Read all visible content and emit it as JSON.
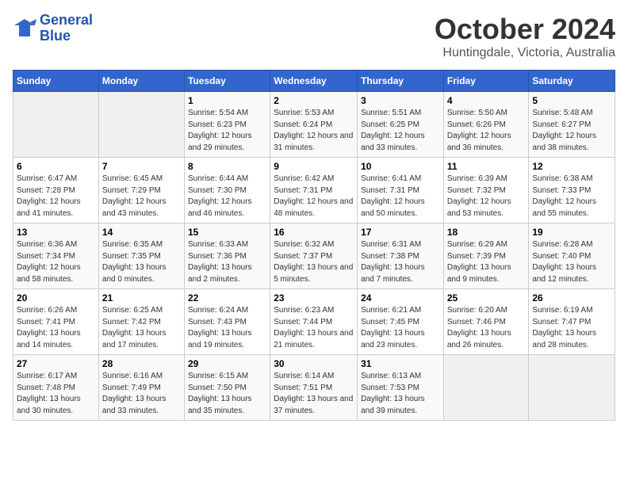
{
  "header": {
    "logo_line1": "General",
    "logo_line2": "Blue",
    "month": "October 2024",
    "location": "Huntingdale, Victoria, Australia"
  },
  "weekdays": [
    "Sunday",
    "Monday",
    "Tuesday",
    "Wednesday",
    "Thursday",
    "Friday",
    "Saturday"
  ],
  "weeks": [
    [
      {
        "day": "",
        "detail": ""
      },
      {
        "day": "",
        "detail": ""
      },
      {
        "day": "1",
        "detail": "Sunrise: 5:54 AM\nSunset: 6:23 PM\nDaylight: 12 hours and 29 minutes."
      },
      {
        "day": "2",
        "detail": "Sunrise: 5:53 AM\nSunset: 6:24 PM\nDaylight: 12 hours and 31 minutes."
      },
      {
        "day": "3",
        "detail": "Sunrise: 5:51 AM\nSunset: 6:25 PM\nDaylight: 12 hours and 33 minutes."
      },
      {
        "day": "4",
        "detail": "Sunrise: 5:50 AM\nSunset: 6:26 PM\nDaylight: 12 hours and 36 minutes."
      },
      {
        "day": "5",
        "detail": "Sunrise: 5:48 AM\nSunset: 6:27 PM\nDaylight: 12 hours and 38 minutes."
      }
    ],
    [
      {
        "day": "6",
        "detail": "Sunrise: 6:47 AM\nSunset: 7:28 PM\nDaylight: 12 hours and 41 minutes."
      },
      {
        "day": "7",
        "detail": "Sunrise: 6:45 AM\nSunset: 7:29 PM\nDaylight: 12 hours and 43 minutes."
      },
      {
        "day": "8",
        "detail": "Sunrise: 6:44 AM\nSunset: 7:30 PM\nDaylight: 12 hours and 46 minutes."
      },
      {
        "day": "9",
        "detail": "Sunrise: 6:42 AM\nSunset: 7:31 PM\nDaylight: 12 hours and 48 minutes."
      },
      {
        "day": "10",
        "detail": "Sunrise: 6:41 AM\nSunset: 7:31 PM\nDaylight: 12 hours and 50 minutes."
      },
      {
        "day": "11",
        "detail": "Sunrise: 6:39 AM\nSunset: 7:32 PM\nDaylight: 12 hours and 53 minutes."
      },
      {
        "day": "12",
        "detail": "Sunrise: 6:38 AM\nSunset: 7:33 PM\nDaylight: 12 hours and 55 minutes."
      }
    ],
    [
      {
        "day": "13",
        "detail": "Sunrise: 6:36 AM\nSunset: 7:34 PM\nDaylight: 12 hours and 58 minutes."
      },
      {
        "day": "14",
        "detail": "Sunrise: 6:35 AM\nSunset: 7:35 PM\nDaylight: 13 hours and 0 minutes."
      },
      {
        "day": "15",
        "detail": "Sunrise: 6:33 AM\nSunset: 7:36 PM\nDaylight: 13 hours and 2 minutes."
      },
      {
        "day": "16",
        "detail": "Sunrise: 6:32 AM\nSunset: 7:37 PM\nDaylight: 13 hours and 5 minutes."
      },
      {
        "day": "17",
        "detail": "Sunrise: 6:31 AM\nSunset: 7:38 PM\nDaylight: 13 hours and 7 minutes."
      },
      {
        "day": "18",
        "detail": "Sunrise: 6:29 AM\nSunset: 7:39 PM\nDaylight: 13 hours and 9 minutes."
      },
      {
        "day": "19",
        "detail": "Sunrise: 6:28 AM\nSunset: 7:40 PM\nDaylight: 13 hours and 12 minutes."
      }
    ],
    [
      {
        "day": "20",
        "detail": "Sunrise: 6:26 AM\nSunset: 7:41 PM\nDaylight: 13 hours and 14 minutes."
      },
      {
        "day": "21",
        "detail": "Sunrise: 6:25 AM\nSunset: 7:42 PM\nDaylight: 13 hours and 17 minutes."
      },
      {
        "day": "22",
        "detail": "Sunrise: 6:24 AM\nSunset: 7:43 PM\nDaylight: 13 hours and 19 minutes."
      },
      {
        "day": "23",
        "detail": "Sunrise: 6:23 AM\nSunset: 7:44 PM\nDaylight: 13 hours and 21 minutes."
      },
      {
        "day": "24",
        "detail": "Sunrise: 6:21 AM\nSunset: 7:45 PM\nDaylight: 13 hours and 23 minutes."
      },
      {
        "day": "25",
        "detail": "Sunrise: 6:20 AM\nSunset: 7:46 PM\nDaylight: 13 hours and 26 minutes."
      },
      {
        "day": "26",
        "detail": "Sunrise: 6:19 AM\nSunset: 7:47 PM\nDaylight: 13 hours and 28 minutes."
      }
    ],
    [
      {
        "day": "27",
        "detail": "Sunrise: 6:17 AM\nSunset: 7:48 PM\nDaylight: 13 hours and 30 minutes."
      },
      {
        "day": "28",
        "detail": "Sunrise: 6:16 AM\nSunset: 7:49 PM\nDaylight: 13 hours and 33 minutes."
      },
      {
        "day": "29",
        "detail": "Sunrise: 6:15 AM\nSunset: 7:50 PM\nDaylight: 13 hours and 35 minutes."
      },
      {
        "day": "30",
        "detail": "Sunrise: 6:14 AM\nSunset: 7:51 PM\nDaylight: 13 hours and 37 minutes."
      },
      {
        "day": "31",
        "detail": "Sunrise: 6:13 AM\nSunset: 7:53 PM\nDaylight: 13 hours and 39 minutes."
      },
      {
        "day": "",
        "detail": ""
      },
      {
        "day": "",
        "detail": ""
      }
    ]
  ]
}
